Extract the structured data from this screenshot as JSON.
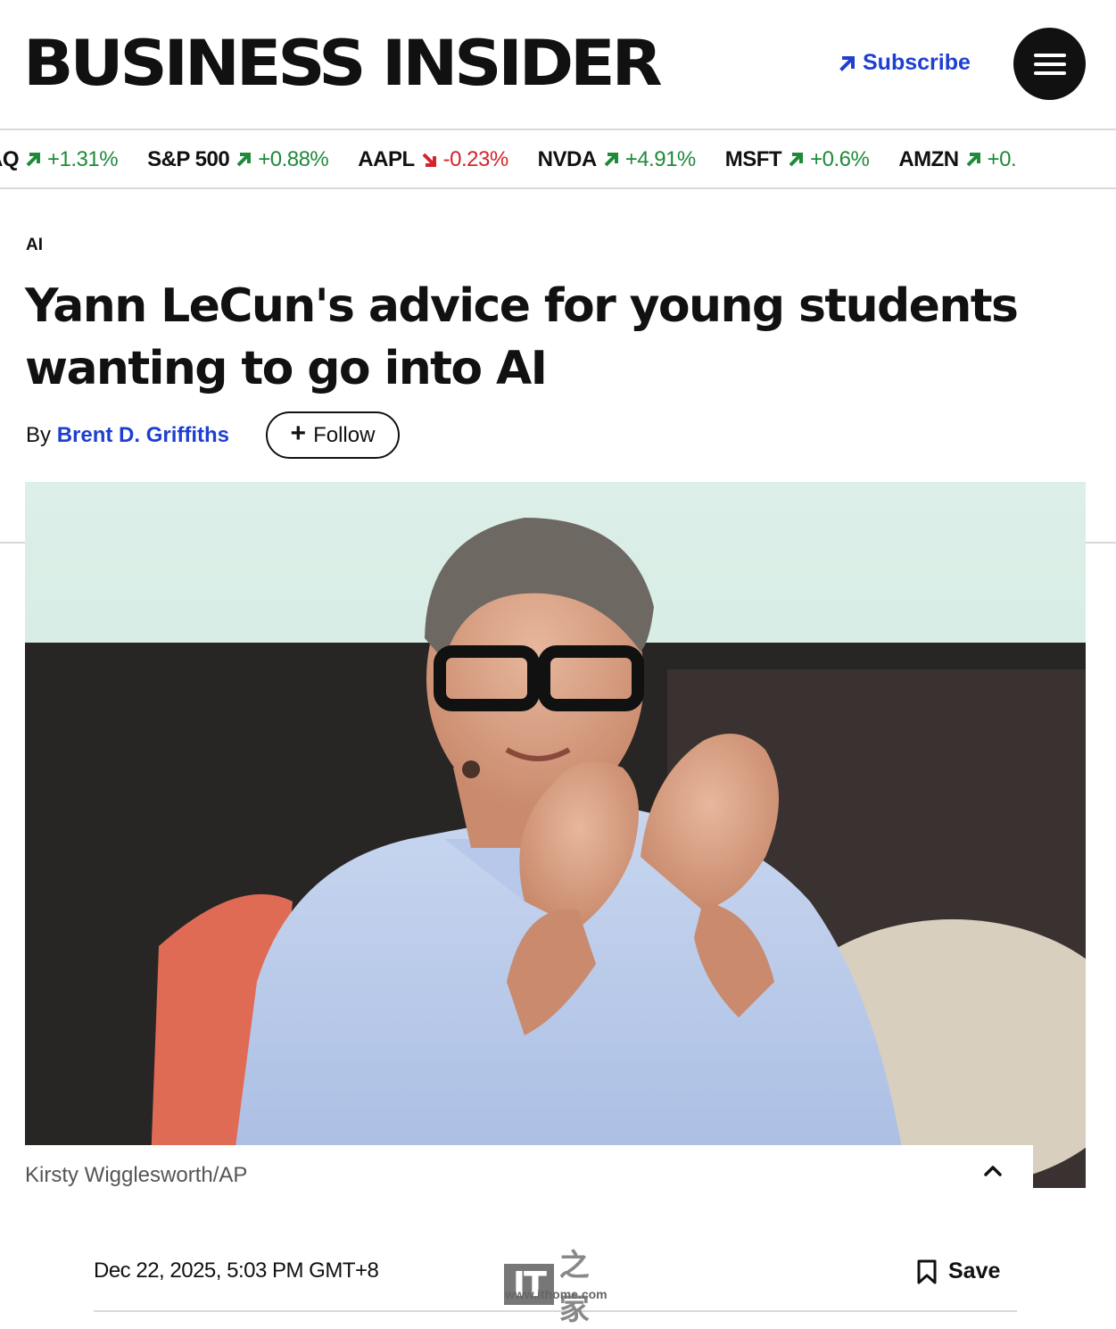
{
  "header": {
    "logo": "BUSINESS INSIDER",
    "subscribe_label": "Subscribe",
    "menu_icon": "hamburger-menu-icon",
    "accent_color": "#1f3fd1"
  },
  "ticker": [
    {
      "symbol": "AQ",
      "direction": "up",
      "change": "+1.31%"
    },
    {
      "symbol": "S&P 500",
      "direction": "up",
      "change": "+0.88%"
    },
    {
      "symbol": "AAPL",
      "direction": "down",
      "change": "-0.23%"
    },
    {
      "symbol": "NVDA",
      "direction": "up",
      "change": "+4.91%"
    },
    {
      "symbol": "MSFT",
      "direction": "up",
      "change": "+0.6%"
    },
    {
      "symbol": "AMZN",
      "direction": "up",
      "change": "+0."
    }
  ],
  "ticker_colors": {
    "up": "#1e8a3a",
    "down": "#d4232b"
  },
  "article": {
    "category": "AI",
    "headline": "Yann LeCun's advice for young students wanting to go into AI",
    "byline_prefix": "By",
    "author": "Brent D. Griffiths",
    "follow_label": "Follow",
    "image_credit": "Kirsty Wigglesworth/AP",
    "date": "Dec 22, 2025, 5:03 PM GMT+8",
    "save_label": "Save"
  },
  "watermark": {
    "logo_text": "IT",
    "url": "www.ithome.com"
  }
}
